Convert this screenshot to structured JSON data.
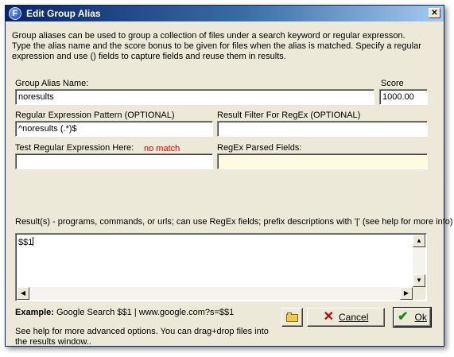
{
  "window": {
    "title": "Edit Group Alias",
    "app_icon_letter": "F",
    "close_glyph": "✕"
  },
  "description": {
    "line1": "Group aliases can be used to group a collection of files under a search keyword or regular expresson.",
    "line2": "Type the alias name and the score bonus to be given for files when the alias is matched.  Specify a regular expression and use () fields to capture fields and reuse them in results."
  },
  "fields": {
    "group_alias_name": {
      "label": "Group Alias Name:",
      "value": "noresults"
    },
    "score": {
      "label": "Score",
      "value": "1000.00"
    },
    "regex_pattern": {
      "label": "Regular Expression Pattern (OPTIONAL)",
      "value": "^noresults (.*)$"
    },
    "result_filter": {
      "label": "Result Filter For RegEx (OPTIONAL)",
      "value": ""
    },
    "test_regex": {
      "label": "Test Regular Expression Here:",
      "status": "no match",
      "value": ""
    },
    "regex_parsed_fields": {
      "label": "RegEx Parsed Fields:",
      "value": ""
    }
  },
  "results": {
    "label": "Result(s) - programs, commands, or urls; can use RegEx fields; prefix descriptions with '|' (see help for more info)",
    "value": "$$1"
  },
  "example": {
    "label": "Example:",
    "text": "Google Search $$1 | www.google.com?s=$$1"
  },
  "help": {
    "text": "See help for more advanced options.  You can drag+drop files into the results window.."
  },
  "buttons": {
    "browse_icon": "folder-open-icon",
    "cancel_label": "Cancel",
    "ok_label": "Ok"
  },
  "colors": {
    "titlebar_start": "#0a246a",
    "dialog_bg": "#ece9d8",
    "readonly_field_bg": "#fffbe0",
    "no_match": "#e00000"
  }
}
